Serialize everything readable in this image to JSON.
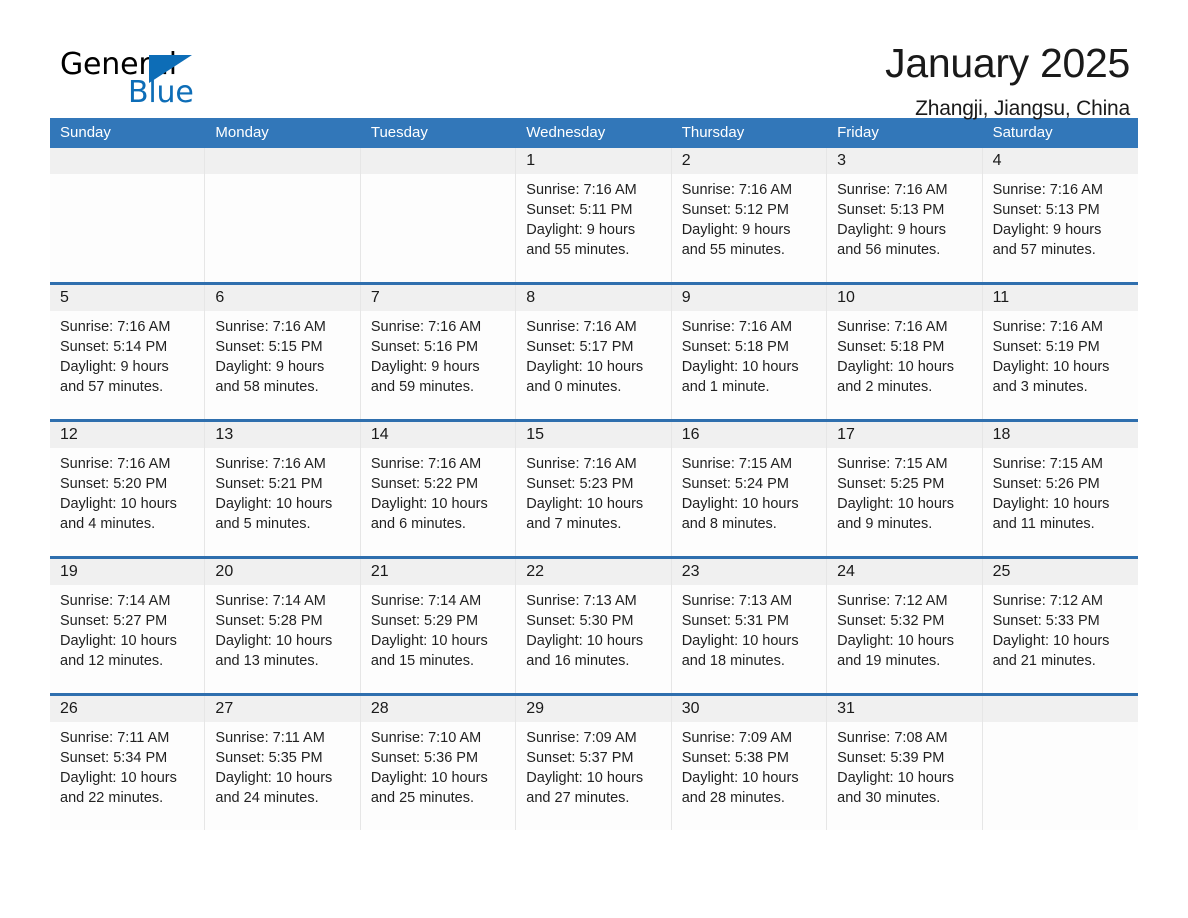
{
  "brand": {
    "name_part1": "General",
    "name_part2": "Blue",
    "accent_color": "#0d6db7"
  },
  "header": {
    "title": "January 2025",
    "location": "Zhangji, Jiangsu, China",
    "header_bg": "#3277b9",
    "row_divider": "#2f6fae",
    "daynum_band": "#f0f0f0"
  },
  "weekdays": [
    "Sunday",
    "Monday",
    "Tuesday",
    "Wednesday",
    "Thursday",
    "Friday",
    "Saturday"
  ],
  "weeks": [
    [
      {
        "day": ""
      },
      {
        "day": ""
      },
      {
        "day": ""
      },
      {
        "day": "1",
        "sunrise": "Sunrise: 7:16 AM",
        "sunset": "Sunset: 5:11 PM",
        "daylight_line1": "Daylight: 9 hours",
        "daylight_line2": "and 55 minutes."
      },
      {
        "day": "2",
        "sunrise": "Sunrise: 7:16 AM",
        "sunset": "Sunset: 5:12 PM",
        "daylight_line1": "Daylight: 9 hours",
        "daylight_line2": "and 55 minutes."
      },
      {
        "day": "3",
        "sunrise": "Sunrise: 7:16 AM",
        "sunset": "Sunset: 5:13 PM",
        "daylight_line1": "Daylight: 9 hours",
        "daylight_line2": "and 56 minutes."
      },
      {
        "day": "4",
        "sunrise": "Sunrise: 7:16 AM",
        "sunset": "Sunset: 5:13 PM",
        "daylight_line1": "Daylight: 9 hours",
        "daylight_line2": "and 57 minutes."
      }
    ],
    [
      {
        "day": "5",
        "sunrise": "Sunrise: 7:16 AM",
        "sunset": "Sunset: 5:14 PM",
        "daylight_line1": "Daylight: 9 hours",
        "daylight_line2": "and 57 minutes."
      },
      {
        "day": "6",
        "sunrise": "Sunrise: 7:16 AM",
        "sunset": "Sunset: 5:15 PM",
        "daylight_line1": "Daylight: 9 hours",
        "daylight_line2": "and 58 minutes."
      },
      {
        "day": "7",
        "sunrise": "Sunrise: 7:16 AM",
        "sunset": "Sunset: 5:16 PM",
        "daylight_line1": "Daylight: 9 hours",
        "daylight_line2": "and 59 minutes."
      },
      {
        "day": "8",
        "sunrise": "Sunrise: 7:16 AM",
        "sunset": "Sunset: 5:17 PM",
        "daylight_line1": "Daylight: 10 hours",
        "daylight_line2": "and 0 minutes."
      },
      {
        "day": "9",
        "sunrise": "Sunrise: 7:16 AM",
        "sunset": "Sunset: 5:18 PM",
        "daylight_line1": "Daylight: 10 hours",
        "daylight_line2": "and 1 minute."
      },
      {
        "day": "10",
        "sunrise": "Sunrise: 7:16 AM",
        "sunset": "Sunset: 5:18 PM",
        "daylight_line1": "Daylight: 10 hours",
        "daylight_line2": "and 2 minutes."
      },
      {
        "day": "11",
        "sunrise": "Sunrise: 7:16 AM",
        "sunset": "Sunset: 5:19 PM",
        "daylight_line1": "Daylight: 10 hours",
        "daylight_line2": "and 3 minutes."
      }
    ],
    [
      {
        "day": "12",
        "sunrise": "Sunrise: 7:16 AM",
        "sunset": "Sunset: 5:20 PM",
        "daylight_line1": "Daylight: 10 hours",
        "daylight_line2": "and 4 minutes."
      },
      {
        "day": "13",
        "sunrise": "Sunrise: 7:16 AM",
        "sunset": "Sunset: 5:21 PM",
        "daylight_line1": "Daylight: 10 hours",
        "daylight_line2": "and 5 minutes."
      },
      {
        "day": "14",
        "sunrise": "Sunrise: 7:16 AM",
        "sunset": "Sunset: 5:22 PM",
        "daylight_line1": "Daylight: 10 hours",
        "daylight_line2": "and 6 minutes."
      },
      {
        "day": "15",
        "sunrise": "Sunrise: 7:16 AM",
        "sunset": "Sunset: 5:23 PM",
        "daylight_line1": "Daylight: 10 hours",
        "daylight_line2": "and 7 minutes."
      },
      {
        "day": "16",
        "sunrise": "Sunrise: 7:15 AM",
        "sunset": "Sunset: 5:24 PM",
        "daylight_line1": "Daylight: 10 hours",
        "daylight_line2": "and 8 minutes."
      },
      {
        "day": "17",
        "sunrise": "Sunrise: 7:15 AM",
        "sunset": "Sunset: 5:25 PM",
        "daylight_line1": "Daylight: 10 hours",
        "daylight_line2": "and 9 minutes."
      },
      {
        "day": "18",
        "sunrise": "Sunrise: 7:15 AM",
        "sunset": "Sunset: 5:26 PM",
        "daylight_line1": "Daylight: 10 hours",
        "daylight_line2": "and 11 minutes."
      }
    ],
    [
      {
        "day": "19",
        "sunrise": "Sunrise: 7:14 AM",
        "sunset": "Sunset: 5:27 PM",
        "daylight_line1": "Daylight: 10 hours",
        "daylight_line2": "and 12 minutes."
      },
      {
        "day": "20",
        "sunrise": "Sunrise: 7:14 AM",
        "sunset": "Sunset: 5:28 PM",
        "daylight_line1": "Daylight: 10 hours",
        "daylight_line2": "and 13 minutes."
      },
      {
        "day": "21",
        "sunrise": "Sunrise: 7:14 AM",
        "sunset": "Sunset: 5:29 PM",
        "daylight_line1": "Daylight: 10 hours",
        "daylight_line2": "and 15 minutes."
      },
      {
        "day": "22",
        "sunrise": "Sunrise: 7:13 AM",
        "sunset": "Sunset: 5:30 PM",
        "daylight_line1": "Daylight: 10 hours",
        "daylight_line2": "and 16 minutes."
      },
      {
        "day": "23",
        "sunrise": "Sunrise: 7:13 AM",
        "sunset": "Sunset: 5:31 PM",
        "daylight_line1": "Daylight: 10 hours",
        "daylight_line2": "and 18 minutes."
      },
      {
        "day": "24",
        "sunrise": "Sunrise: 7:12 AM",
        "sunset": "Sunset: 5:32 PM",
        "daylight_line1": "Daylight: 10 hours",
        "daylight_line2": "and 19 minutes."
      },
      {
        "day": "25",
        "sunrise": "Sunrise: 7:12 AM",
        "sunset": "Sunset: 5:33 PM",
        "daylight_line1": "Daylight: 10 hours",
        "daylight_line2": "and 21 minutes."
      }
    ],
    [
      {
        "day": "26",
        "sunrise": "Sunrise: 7:11 AM",
        "sunset": "Sunset: 5:34 PM",
        "daylight_line1": "Daylight: 10 hours",
        "daylight_line2": "and 22 minutes."
      },
      {
        "day": "27",
        "sunrise": "Sunrise: 7:11 AM",
        "sunset": "Sunset: 5:35 PM",
        "daylight_line1": "Daylight: 10 hours",
        "daylight_line2": "and 24 minutes."
      },
      {
        "day": "28",
        "sunrise": "Sunrise: 7:10 AM",
        "sunset": "Sunset: 5:36 PM",
        "daylight_line1": "Daylight: 10 hours",
        "daylight_line2": "and 25 minutes."
      },
      {
        "day": "29",
        "sunrise": "Sunrise: 7:09 AM",
        "sunset": "Sunset: 5:37 PM",
        "daylight_line1": "Daylight: 10 hours",
        "daylight_line2": "and 27 minutes."
      },
      {
        "day": "30",
        "sunrise": "Sunrise: 7:09 AM",
        "sunset": "Sunset: 5:38 PM",
        "daylight_line1": "Daylight: 10 hours",
        "daylight_line2": "and 28 minutes."
      },
      {
        "day": "31",
        "sunrise": "Sunrise: 7:08 AM",
        "sunset": "Sunset: 5:39 PM",
        "daylight_line1": "Daylight: 10 hours",
        "daylight_line2": "and 30 minutes."
      },
      {
        "day": ""
      }
    ]
  ]
}
